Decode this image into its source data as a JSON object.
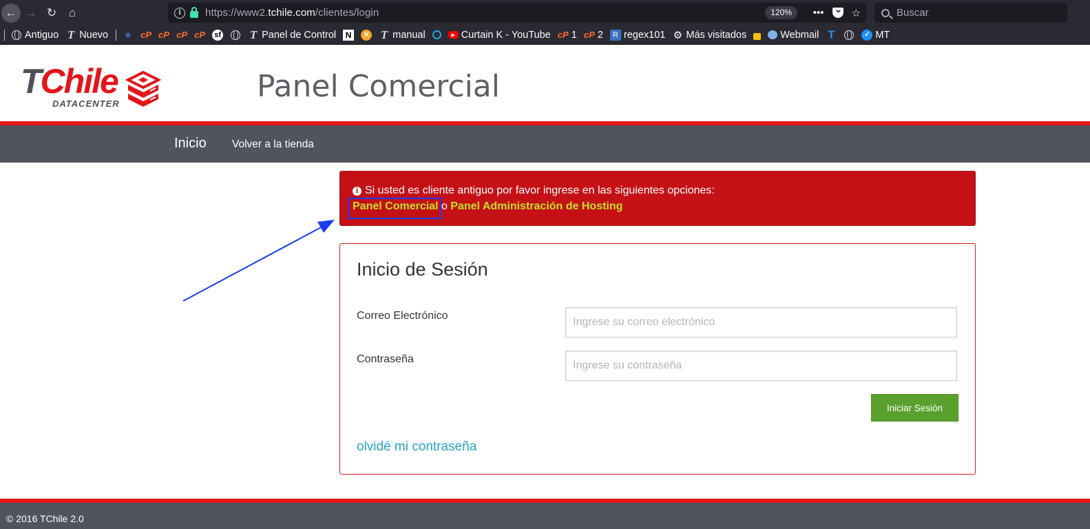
{
  "browser": {
    "url_prefix": "https://www2.",
    "url_host": "tchile.com",
    "url_path": "/clientes/login",
    "zoom": "120%",
    "more_label": "•••",
    "star_label": "☆",
    "search_placeholder": "Buscar"
  },
  "bookmarks": [
    {
      "label": "Antiguo",
      "icon": "globe-icon"
    },
    {
      "label": "Nuevo",
      "icon": "tchile-icon"
    },
    {
      "label": "Panel de Control",
      "icon": "tchile-icon"
    },
    {
      "label": "manual",
      "icon": "tchile-icon"
    },
    {
      "label": "Curtain K - YouTube",
      "icon": "youtube-icon"
    },
    {
      "label": "1",
      "icon": "cpanel-icon"
    },
    {
      "label": "2",
      "icon": "cpanel-icon"
    },
    {
      "label": "regex101",
      "icon": "regex101-icon"
    },
    {
      "label": "Más visitados",
      "icon": "gear-icon"
    },
    {
      "label": "Webmail",
      "icon": "webmail-icon"
    },
    {
      "label": "MT",
      "icon": "check-badge-icon"
    }
  ],
  "header": {
    "logo_t": "T",
    "logo_chile": "Chile",
    "logo_sub": "DATACENTER",
    "title": "Panel Comercial"
  },
  "nav": {
    "inicio": "Inicio",
    "volver": "Volver a la tienda"
  },
  "alert": {
    "icon": "i",
    "message": "Si usted es cliente antiguo por favor ingrese en las siguientes opciones:",
    "link1": "Panel Comercial",
    "connector": " o ",
    "link2": "Panel Administración de Hosting"
  },
  "login": {
    "title": "Inicio de Sesión",
    "email_label": "Correo Electrónico",
    "email_placeholder": "Ingrese su correo electrónico",
    "password_label": "Contraseña",
    "password_placeholder": "Ingrese su contraseña",
    "submit": "Iniciar Sesión",
    "forgot": "olvidé mi contraseña"
  },
  "footer": {
    "text": "© 2016 TChile 2.0"
  },
  "colors": {
    "brand_red": "#e3161b",
    "nav_gray": "#50545e",
    "alert_red": "#c51116",
    "link_yellow": "#c3e021",
    "button_green": "#5aa02c",
    "link_blue": "#25a3c6",
    "annotation_blue": "#1a3cf0"
  }
}
